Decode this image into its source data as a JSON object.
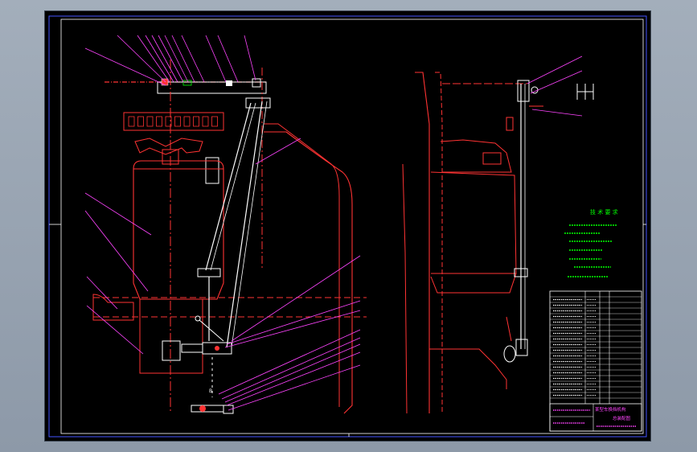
{
  "sheet": {
    "background": "#000000",
    "frame_color": "#4455ff",
    "outline_color": "#ff2a2a",
    "centerline_color": "#ff3333",
    "leader_color": "#ff44ff",
    "text_color": "#00ff00"
  },
  "notes": {
    "heading": "技 术 要 求"
  },
  "title_block": {
    "drawing_name_line1": "某型车换挡机构",
    "drawing_name_line2": "总装配图"
  },
  "view_labels": {
    "section_mark": "B"
  },
  "icons": {
    "gear_shift_pattern": "shift-pattern-icon"
  }
}
